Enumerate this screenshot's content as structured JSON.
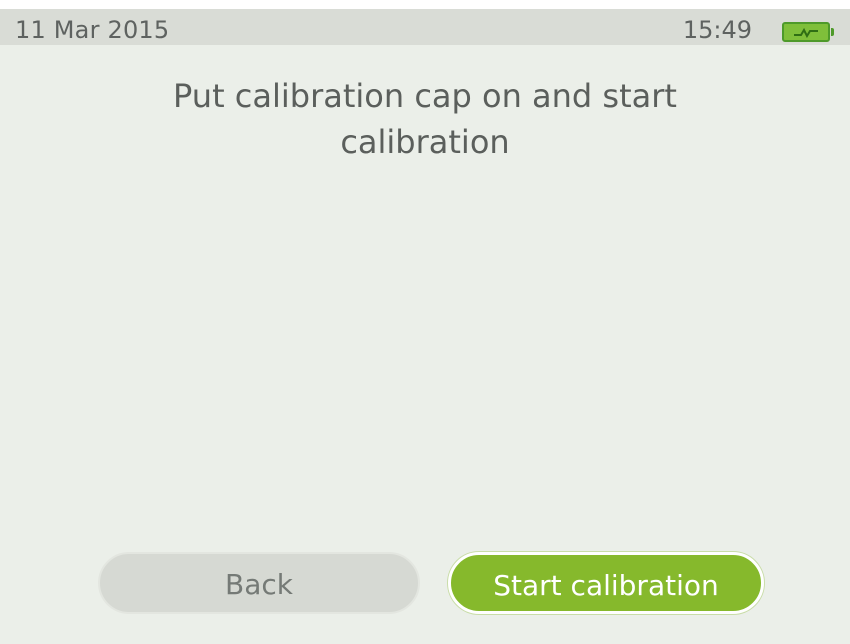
{
  "status_bar": {
    "date": "11 Mar 2015",
    "time": "15:49",
    "battery_icon": "battery-charging-icon",
    "battery_color": "#7fbf3a"
  },
  "main": {
    "instruction": "Put calibration cap on and start calibration"
  },
  "buttons": {
    "back_label": "Back",
    "start_label": "Start calibration",
    "start_color": "#86b92c",
    "back_color": "#d6d9d3"
  }
}
